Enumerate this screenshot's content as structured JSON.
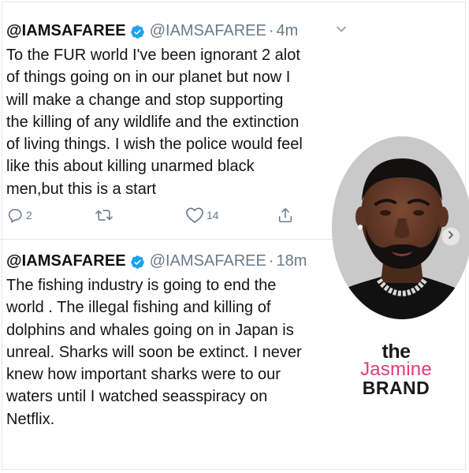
{
  "tweets": [
    {
      "display_name": "@IAMSAFAREE",
      "handle": "@IAMSAFAREE",
      "separator": "·",
      "time": "4m",
      "text_lines": [
        "To the FUR world I've been ignorant 2 alot",
        "of things going on in our planet but now I",
        "will make a change and stop supporting",
        "the killing of any wildlife and the extinction",
        "of living things. I wish the police would feel",
        "like this about killing unarmed black",
        "men,but this is a start"
      ],
      "reply_count": "2",
      "retweet_count": "",
      "like_count": "14"
    },
    {
      "display_name": "@IAMSAFAREE",
      "handle": "@IAMSAFAREE",
      "separator": "·",
      "time": "18m",
      "text_lines": [
        "The fishing industry is going to end the",
        "world . The illegal fishing and killing of",
        "dolphins and whales going on in Japan is",
        "unreal. Sharks will soon be extinct. I never",
        "knew how important sharks were to our",
        "waters until I watched seasspiracy on",
        "Netflix."
      ]
    }
  ],
  "brand": {
    "the": "the",
    "jasmine": "Jasmine",
    "brand": "BRAND"
  },
  "icons": {
    "verified": "verified-badge-icon",
    "chevron": "chevron-down-icon",
    "reply": "reply-icon",
    "retweet": "retweet-icon",
    "like": "heart-icon",
    "share": "share-icon",
    "next": "chevron-right-icon"
  },
  "colors": {
    "verified": "#1DA1F2",
    "muted": "#6B7B8A",
    "brand_pink": "#E23B78"
  }
}
